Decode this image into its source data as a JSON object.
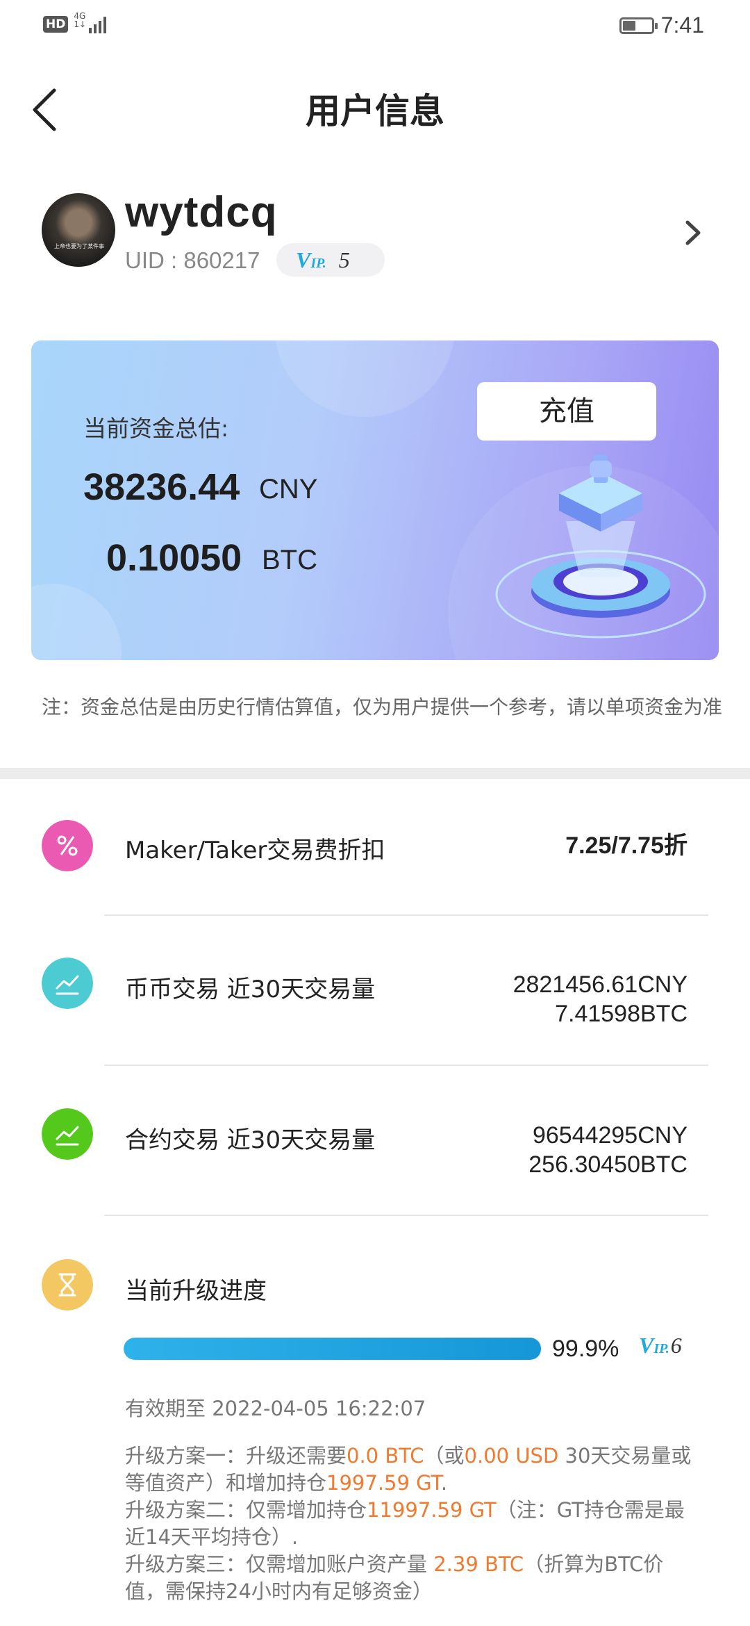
{
  "status_bar": {
    "hd": "HD",
    "network": "4G",
    "network_sub": "1↓",
    "time": "7:41"
  },
  "header": {
    "title": "用户信息"
  },
  "profile": {
    "username": "wytdcq",
    "uid": "UID : 860217",
    "vip_logo": "V",
    "vip_logo_small": "IP.",
    "vip_level": "5",
    "avatar_caption": "上帝也要为了某件事"
  },
  "balance": {
    "label": "当前资金总估:",
    "cny_amount": "38236.44",
    "cny_unit": "CNY",
    "btc_amount": "0.10050",
    "btc_unit": "BTC",
    "recharge_label": "充值"
  },
  "note": "注：资金总估是由历史行情估算值，仅为用户提供一个参考，请以单项资金为准",
  "rows": {
    "fee": {
      "label": "Maker/Taker交易费折扣",
      "value": "7.25/7.75",
      "suffix": "折",
      "color": "#ea5ab3"
    },
    "spot": {
      "label": "币币交易  近30天交易量",
      "value_cny": "2821456.61CNY",
      "value_btc": "7.41598BTC",
      "color": "#4ccbd3"
    },
    "futures": {
      "label": "合约交易  近30天交易量",
      "value_cny": "96544295CNY",
      "value_btc": "256.30450BTC",
      "color": "#55c81c"
    },
    "upgrade": {
      "label": "当前升级进度",
      "color": "#f3c863"
    }
  },
  "progress": {
    "percent": 99.9,
    "percent_text": "99.9%",
    "next_vip_logo": "V",
    "next_vip_logo_small": "IP.",
    "next_vip_level": "6"
  },
  "expire": "有效期至 2022-04-05 16:22:07",
  "plans": {
    "plan1_a": "升级方案一：升级还需要",
    "plan1_hl1": "0.0 BTC",
    "plan1_b": "（或",
    "plan1_hl2": "0.00 USD",
    "plan1_c": " 30天交易量或等值资产）和增加持仓",
    "plan1_hl3": "1997.59 GT",
    "plan1_d": ".",
    "plan2_a": "升级方案二：仅需增加持仓",
    "plan2_hl": "11997.59 GT",
    "plan2_b": "（注：GT持仓需是最近14天平均持仓）.",
    "plan3_a": "升级方案三：仅需增加账户资产量 ",
    "plan3_hl": "2.39 BTC",
    "plan3_b": "（折算为BTC价值，需保持24小时内有足够资金）"
  }
}
